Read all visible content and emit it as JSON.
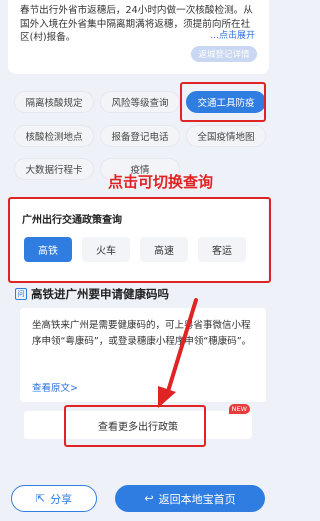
{
  "notice": {
    "text": "春节出行外省市返穗后，24小时内做一次核酸检测。从国外入境在外省集中隔离期满将返穗，须提前向所在社区(村)报备。",
    "expand": "…点击展开",
    "register_button": "返城登记详情"
  },
  "tags": {
    "row1": [
      "隔离核酸规定",
      "风险等级查询",
      "交通工具防疫"
    ],
    "row2": [
      "核酸检测地点",
      "报备登记电话",
      "全国疫情地图"
    ],
    "row3": [
      "大数据行程卡",
      "疫情"
    ]
  },
  "annotation": "点击可切换查询",
  "policy": {
    "title": "广州出行交通政策查询",
    "modes": [
      "高铁",
      "火车",
      "高速",
      "客运"
    ]
  },
  "info": {
    "icon_char": "问",
    "title": "高铁进广州要申请健康码吗",
    "body": "坐高铁来广州是需要健康码的，可上粤省事微信小程序申领“粤康码”，或登录穗康小程序申领“穗康码”。",
    "link": "查看原文>"
  },
  "more_policy": {
    "label": "查看更多出行政策",
    "badge": "NEW"
  },
  "footer": {
    "share": "分享",
    "home": "返回本地宝首页"
  },
  "colors": {
    "accent": "#2f7de1",
    "annotation_red": "#e02323"
  }
}
